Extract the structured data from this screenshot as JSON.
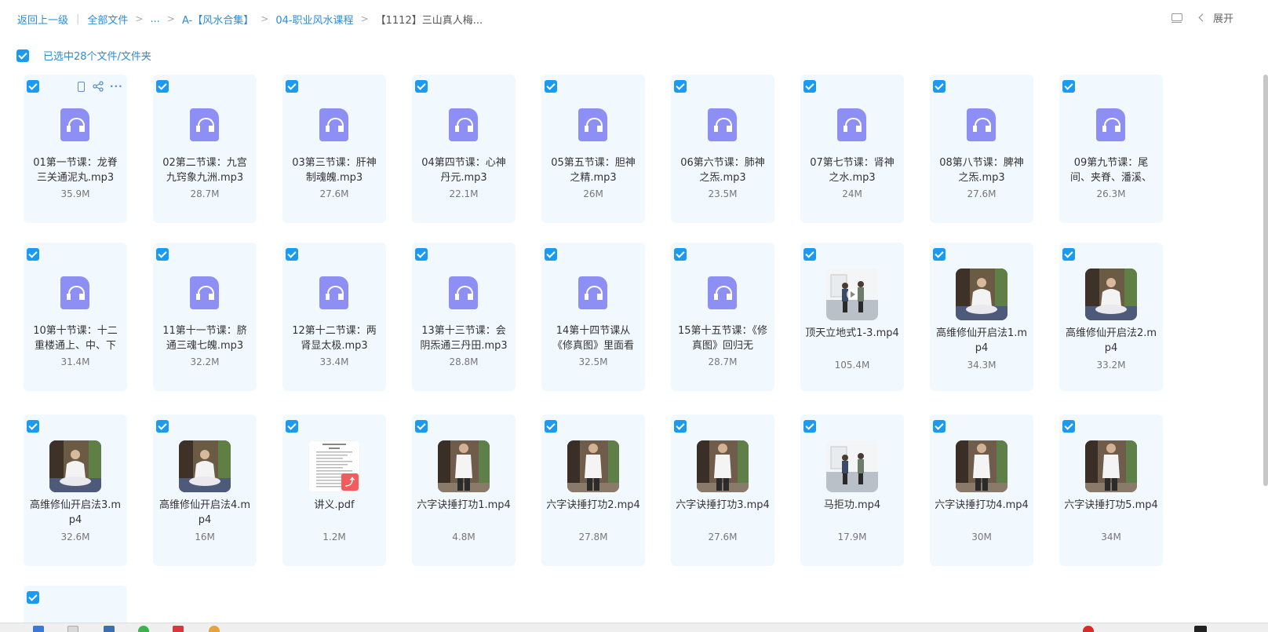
{
  "breadcrumb": {
    "back": "返回上一级",
    "items": [
      "全部文件",
      "...",
      "A-【风水合集】",
      "04-职业风水课程",
      "【1112】三山真人梅..."
    ]
  },
  "toolbar": {
    "expand_label": "展开"
  },
  "selection": {
    "label": "已选中28个文件/文件夹",
    "checked": true
  },
  "files": [
    {
      "name": "01第一节课：龙脊三关通泥丸.mp3",
      "size": "35.9M",
      "type": "audio",
      "checked": true
    },
    {
      "name": "02第二节课：九宫九窍象九洲.mp3",
      "size": "28.7M",
      "type": "audio",
      "checked": true
    },
    {
      "name": "03第三节课：肝神制魂魄.mp3",
      "size": "27.6M",
      "type": "audio",
      "checked": true
    },
    {
      "name": "04第四节课：心神丹元.mp3",
      "size": "22.1M",
      "type": "audio",
      "checked": true
    },
    {
      "name": "05第五节课：胆神之精.mp3",
      "size": "26M",
      "type": "audio",
      "checked": true
    },
    {
      "name": "06第六节课：肺神之炁.mp3",
      "size": "23.5M",
      "type": "audio",
      "checked": true
    },
    {
      "name": "07第七节课：肾神之水.mp3",
      "size": "24M",
      "type": "audio",
      "checked": true
    },
    {
      "name": "08第八节课：脾神之炁.mp3",
      "size": "27.6M",
      "type": "audio",
      "checked": true
    },
    {
      "name": "09第九节课：尾间、夹脊、潘溪、",
      "size": "26.3M",
      "type": "audio",
      "checked": true
    },
    {
      "name": "10第十节课：十二重楼通上、中、下",
      "size": "31.4M",
      "type": "audio",
      "checked": true
    },
    {
      "name": "11第十一节课：脐通三魂七魄.mp3",
      "size": "32.2M",
      "type": "audio",
      "checked": true
    },
    {
      "name": "12第十二节课：两肾显太极.mp3",
      "size": "33.4M",
      "type": "audio",
      "checked": true
    },
    {
      "name": "13第十三节课：会阴炁通三丹田.mp3",
      "size": "28.8M",
      "type": "audio",
      "checked": true
    },
    {
      "name": "14第十四节课从《修真图》里面看",
      "size": "32.5M",
      "type": "audio",
      "checked": true
    },
    {
      "name": "15第十五节课：《修真图》回归无",
      "size": "28.7M",
      "type": "audio",
      "checked": true
    },
    {
      "name": "顶天立地式1-3.mp4",
      "size": "105.4M",
      "type": "video",
      "scene": "room",
      "checked": true
    },
    {
      "name": "高维修仙开启法1.mp4",
      "size": "34.3M",
      "type": "video",
      "scene": "meditate",
      "checked": true
    },
    {
      "name": "高维修仙开启法2.mp4",
      "size": "33.2M",
      "type": "video",
      "scene": "meditate",
      "checked": true
    },
    {
      "name": "高维修仙开启法3.mp4",
      "size": "32.6M",
      "type": "video",
      "scene": "meditate",
      "checked": true
    },
    {
      "name": "高维修仙开启法4.mp4",
      "size": "16M",
      "type": "video",
      "scene": "meditate",
      "checked": true
    },
    {
      "name": "讲义.pdf",
      "size": "1.2M",
      "type": "pdf",
      "checked": true
    },
    {
      "name": "六字诀捶打功1.mp4",
      "size": "4.8M",
      "type": "video",
      "scene": "standing",
      "checked": true
    },
    {
      "name": "六字诀捶打功2.mp4",
      "size": "27.8M",
      "type": "video",
      "scene": "standing",
      "checked": true
    },
    {
      "name": "六字诀捶打功3.mp4",
      "size": "27.6M",
      "type": "video",
      "scene": "standing",
      "checked": true
    },
    {
      "name": "马拒功.mp4",
      "size": "17.9M",
      "type": "video",
      "scene": "room",
      "checked": true
    },
    {
      "name": "六字诀捶打功4.mp4",
      "size": "30M",
      "type": "video",
      "scene": "standing",
      "checked": true
    },
    {
      "name": "六字诀捶打功5.mp4",
      "size": "34M",
      "type": "video",
      "scene": "standing",
      "checked": true
    },
    {
      "name": "",
      "size": "",
      "type": "partial",
      "checked": true
    }
  ],
  "colors": {
    "accent": "#1a9af0",
    "link": "#2b8cd6",
    "card_bg": "#f2f9fe",
    "audio_icon": "#8d8ff5",
    "pdf_badge": "#f25c5c"
  },
  "icons": {
    "card_actions": [
      "phone-icon",
      "share-icon",
      "more-icon"
    ]
  }
}
